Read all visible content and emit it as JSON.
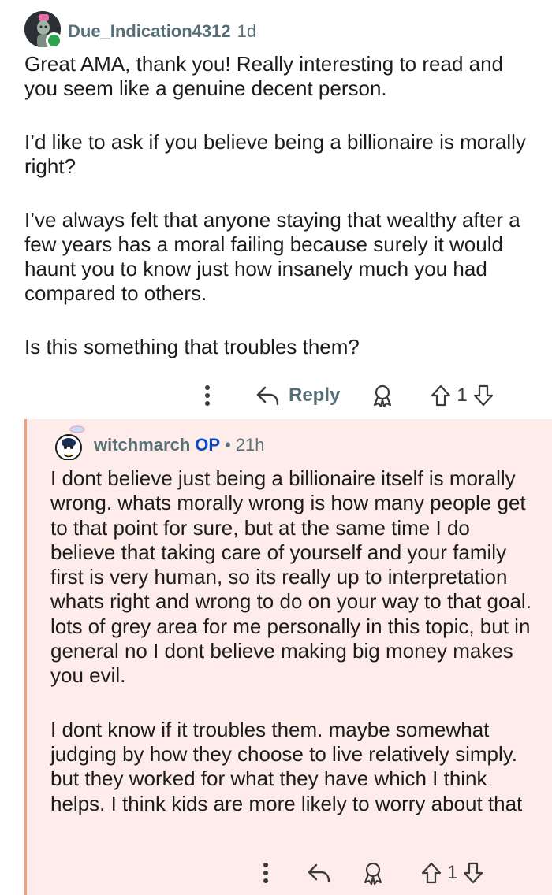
{
  "top_comment": {
    "author": "Due_Indication4312",
    "time": "1d",
    "paragraphs": [
      "Great AMA, thank you! Really interesting to read and you seem like a genuine decent person.",
      "I’d like to ask if you believe being a billionaire is morally right?",
      "I’ve always felt that anyone staying that wealthy after a few years has a moral failing because surely it would haunt you to know just how insanely much you had compared to others.",
      "Is this something that troubles them?"
    ],
    "actions": {
      "more_icon": "more-vertical-icon",
      "reply_icon": "reply-arrow-icon",
      "reply_label": "Reply",
      "award_icon": "award-icon",
      "upvote_icon": "upvote-arrow-icon",
      "vote_count": "1",
      "downvote_icon": "downvote-arrow-icon"
    }
  },
  "reply_comment": {
    "author": "witchmarch",
    "op_label": "OP",
    "separator": "•",
    "time": "21h",
    "highlight_color": "#fdecea",
    "thread_line_color": "#f2a27a",
    "paragraphs": [
      "I dont believe just being a billionaire itself is morally wrong. whats morally wrong is how many people get to that point for sure, but at the same time I do believe that taking care of yourself and your family first is very human, so its really up to interpretation whats right and wrong to do on your way to that goal. lots of grey area for me personally in this topic, but in general no I dont believe making big money makes you evil.",
      "I dont know if it troubles them. maybe somewhat judging by how they choose to live relatively simply. but they worked for what they have which I think helps. I think kids are more likely to worry about that"
    ],
    "actions": {
      "more_icon": "more-vertical-icon",
      "reply_icon": "reply-arrow-icon",
      "award_icon": "award-icon",
      "upvote_icon": "upvote-arrow-icon",
      "vote_count": "1",
      "downvote_icon": "downvote-arrow-icon"
    }
  },
  "colors": {
    "meta_text": "#576f76",
    "op_badge": "#0a49c7",
    "online_status": "#2ea44f"
  }
}
